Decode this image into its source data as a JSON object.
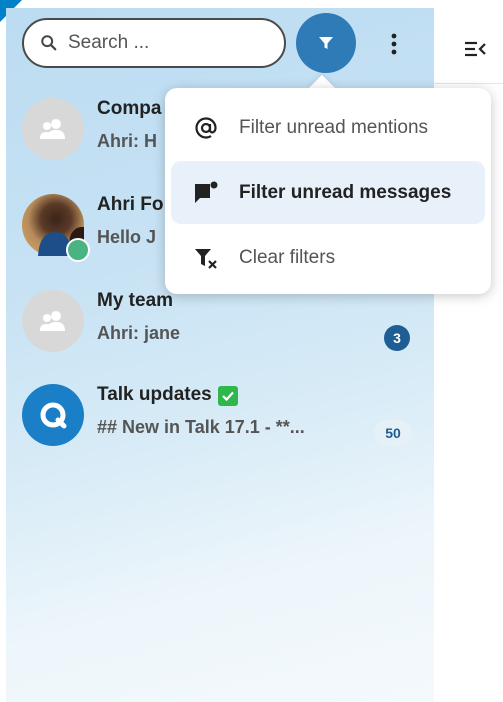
{
  "search": {
    "placeholder": "Search ..."
  },
  "icons": {
    "search": "magnifier-icon",
    "filter": "filter-icon",
    "more": "kebab-icon",
    "sidebar_toggle": "menu-collapse-icon",
    "mention": "at-icon",
    "message_flag": "message-flag-icon",
    "clear_filter": "filter-remove-icon",
    "group_avatar": "group-icon",
    "talk_logo": "talk-logo",
    "verified": "check-icon"
  },
  "colors": {
    "accent": "#2e7bb8",
    "badge_dark": "#1f5e94",
    "status_online": "#49b382",
    "verified": "#2eb84c"
  },
  "conversations": [
    {
      "name": "Compa",
      "preview": "Ahri: H",
      "badge": ""
    },
    {
      "name": "Ahri Fo",
      "preview": "Hello J",
      "badge": ""
    },
    {
      "name": "My team",
      "preview": "Ahri: jane",
      "badge": "3"
    },
    {
      "name": "Talk updates",
      "preview": "## New in Talk 17.1 - **...",
      "badge": "50"
    }
  ],
  "filter_menu": {
    "items": [
      {
        "label": "Filter unread mentions",
        "active": false
      },
      {
        "label": "Filter unread messages",
        "active": true
      },
      {
        "label": "Clear filters",
        "active": false
      }
    ]
  }
}
